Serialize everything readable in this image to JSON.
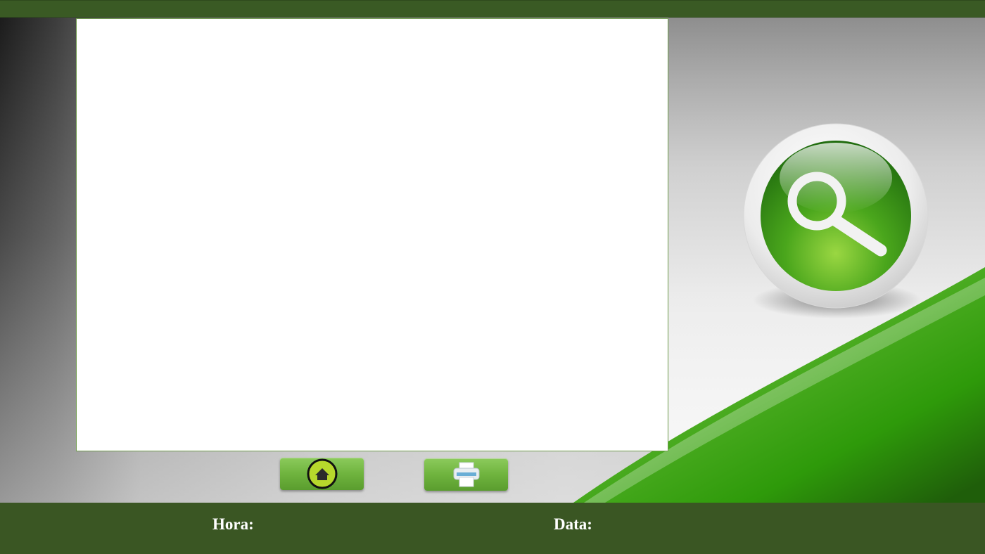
{
  "footer": {
    "time_label": "Hora:",
    "date_label": "Data:"
  },
  "buttons": {
    "home_icon": "home-icon",
    "print_icon": "printer-icon",
    "search_icon": "magnifier-icon"
  },
  "colors": {
    "header_footer": "#3a5a24",
    "button_green": "#6fb43e",
    "orb_green": "#3f9a1a",
    "panel_border": "#6d9a4a"
  }
}
